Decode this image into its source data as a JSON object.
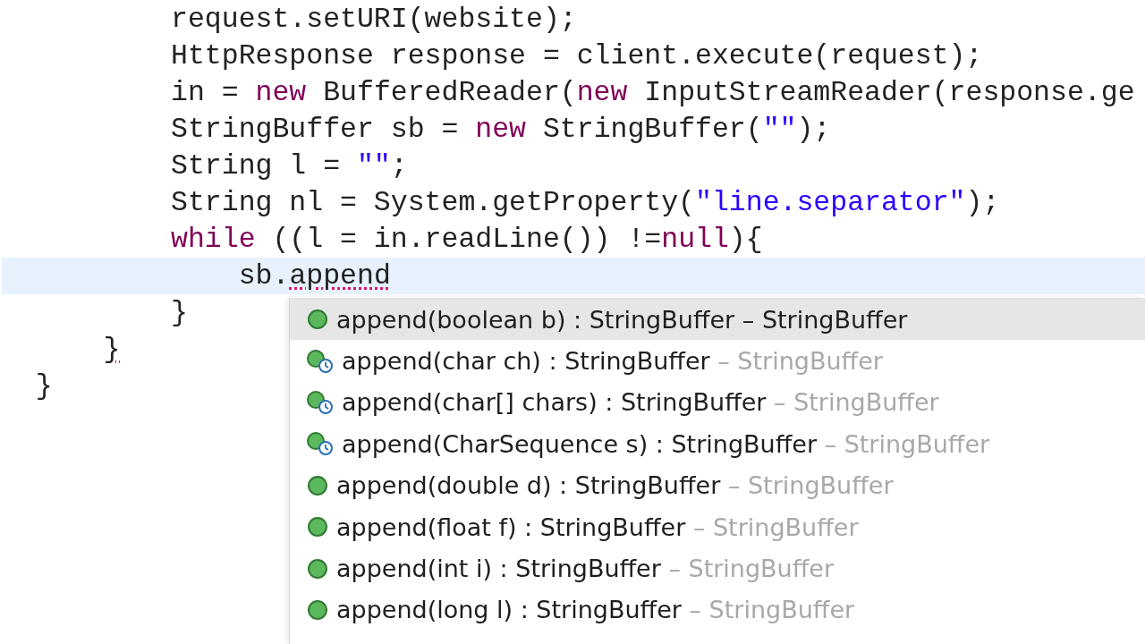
{
  "editor": {
    "lines": [
      {
        "current": false,
        "tokens": [
          {
            "text": "          request.setURI(website);",
            "kind": "plain"
          }
        ]
      },
      {
        "current": false,
        "tokens": [
          {
            "text": "          HttpResponse response = client.execute(request);",
            "kind": "plain"
          }
        ]
      },
      {
        "current": false,
        "tokens": [
          {
            "text": "          in = ",
            "kind": "plain"
          },
          {
            "text": "new",
            "kind": "keyword"
          },
          {
            "text": " BufferedReader(",
            "kind": "plain"
          },
          {
            "text": "new",
            "kind": "keyword"
          },
          {
            "text": " InputStreamReader(response.ge",
            "kind": "plain"
          }
        ]
      },
      {
        "current": false,
        "tokens": [
          {
            "text": "          StringBuffer sb = ",
            "kind": "plain"
          },
          {
            "text": "new",
            "kind": "keyword"
          },
          {
            "text": " StringBuffer(",
            "kind": "plain"
          },
          {
            "text": "\"\"",
            "kind": "string"
          },
          {
            "text": ");",
            "kind": "plain"
          }
        ]
      },
      {
        "current": false,
        "tokens": [
          {
            "text": "          String l = ",
            "kind": "plain"
          },
          {
            "text": "\"\"",
            "kind": "string"
          },
          {
            "text": ";",
            "kind": "plain"
          }
        ]
      },
      {
        "current": false,
        "tokens": [
          {
            "text": "          String nl = System.getProperty(",
            "kind": "plain"
          },
          {
            "text": "\"line.separator\"",
            "kind": "string"
          },
          {
            "text": ");",
            "kind": "plain"
          }
        ]
      },
      {
        "current": false,
        "tokens": [
          {
            "text": "          while",
            "kind": "keyword"
          },
          {
            "text": " ((l = in.readLine()) !=",
            "kind": "plain"
          },
          {
            "text": "null",
            "kind": "keyword"
          },
          {
            "text": "){",
            "kind": "plain"
          }
        ]
      },
      {
        "current": true,
        "tokens": [
          {
            "text": "              sb.",
            "kind": "plain"
          },
          {
            "text": "append",
            "kind": "error"
          }
        ]
      },
      {
        "current": false,
        "tokens": [
          {
            "text": "          }",
            "kind": "plain"
          }
        ]
      },
      {
        "current": false,
        "tokens": [
          {
            "text": "      }",
            "kind": "error"
          }
        ]
      },
      {
        "current": false,
        "tokens": [
          {
            "text": "  }",
            "kind": "plain"
          }
        ]
      }
    ]
  },
  "completion": {
    "items": [
      {
        "kind": "method",
        "signature": "append(boolean b) : StringBuffer",
        "qualifier": " – StringBuffer",
        "selected": true
      },
      {
        "kind": "overlay",
        "signature": "append(char ch) : StringBuffer",
        "qualifier": " – StringBuffer",
        "selected": false
      },
      {
        "kind": "overlay",
        "signature": "append(char[] chars) : StringBuffer",
        "qualifier": " – StringBuffer",
        "selected": false
      },
      {
        "kind": "overlay",
        "signature": "append(CharSequence s) : StringBuffer",
        "qualifier": " – StringBuffer",
        "selected": false
      },
      {
        "kind": "method",
        "signature": "append(double d) : StringBuffer",
        "qualifier": " – StringBuffer",
        "selected": false
      },
      {
        "kind": "method",
        "signature": "append(float f) : StringBuffer",
        "qualifier": " – StringBuffer",
        "selected": false
      },
      {
        "kind": "method",
        "signature": "append(int i) : StringBuffer",
        "qualifier": " – StringBuffer",
        "selected": false
      },
      {
        "kind": "method",
        "signature": "append(long l) : StringBuffer",
        "qualifier": " – StringBuffer",
        "selected": false
      }
    ]
  }
}
